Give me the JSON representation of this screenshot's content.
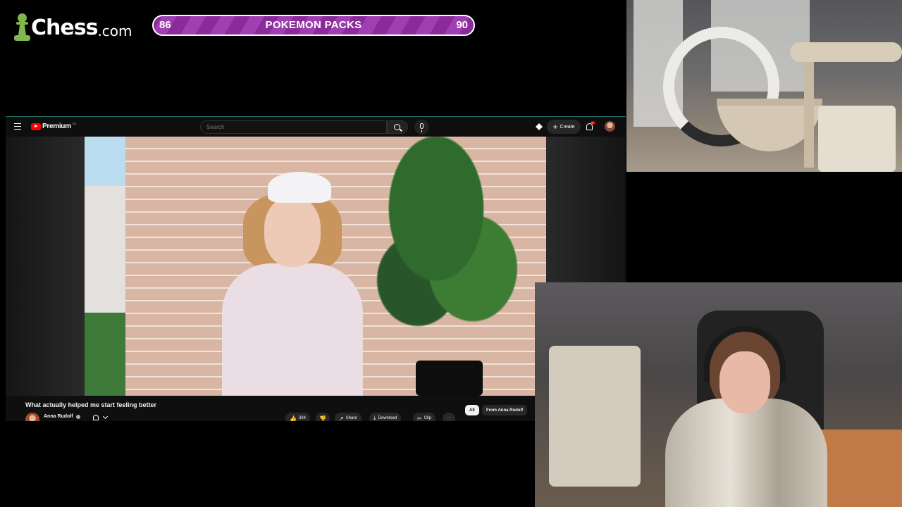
{
  "overlay": {
    "logo_word": "Chess",
    "logo_suffix": ".com",
    "pack_bar": {
      "current": "86",
      "label": "POKEMON PACKS",
      "goal": "90",
      "progress": 0.955
    }
  },
  "youtube": {
    "brand": "Premium",
    "brand_region": "DE",
    "search_placeholder": "Search",
    "create_label": "Create",
    "notification_badge": "9+",
    "video_title": "What actually helped me start feeling better",
    "channel_name": "Anna Rudolf",
    "actions": {
      "like_count": "334",
      "share_label": "Share",
      "download_label": "Download",
      "clip_label": "Clip",
      "more_label": "···"
    },
    "chips": [
      "All",
      "From Anna Rudolf"
    ]
  },
  "colors": {
    "chess_green": "#81b64c",
    "pack_bar_purple": "#9b35ad",
    "youtube_red": "#ff0000",
    "youtube_bg": "#0f0f0f"
  }
}
